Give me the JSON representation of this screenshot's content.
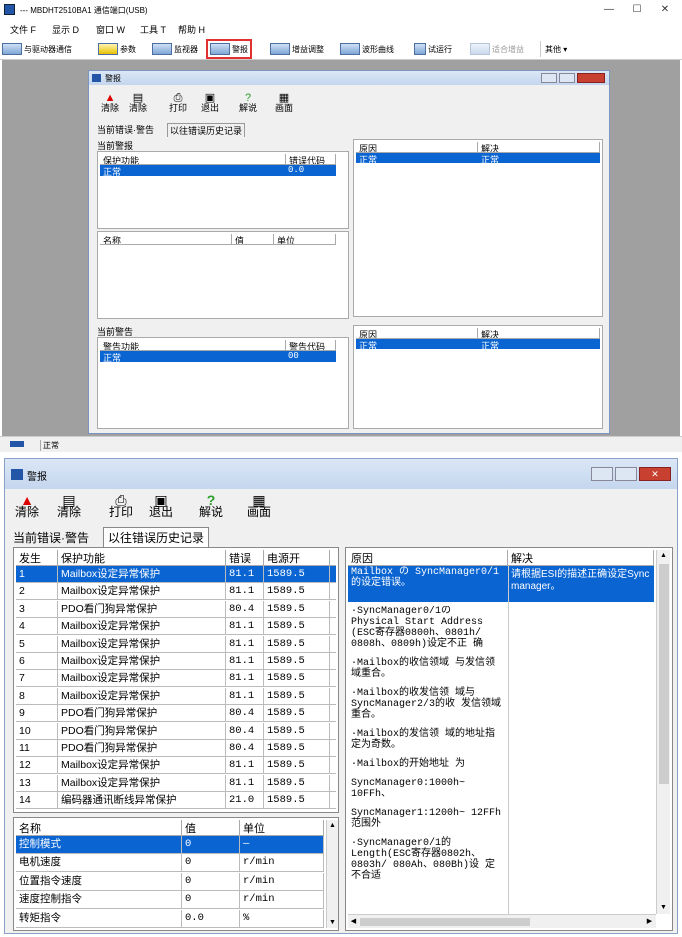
{
  "top": {
    "title": "--- MBDHT2510BA1  通信端口(USB)",
    "menu": [
      "文件 F",
      "显示 D",
      "窗口 W",
      "工具 T",
      "帮助 H"
    ],
    "toolbar": [
      "与驱动器通信",
      "参数",
      "监视器",
      "警报",
      "增益调整",
      "波形曲线",
      "试运行",
      "适合增益",
      "其他 ▾"
    ],
    "status": "正常",
    "alarm_window": {
      "title": "警报",
      "tools": [
        "清除",
        "清除",
        "打印",
        "退出",
        "解说",
        "画面"
      ],
      "tabs": [
        "当前错误·警告",
        "以往错误历史记录"
      ],
      "current_alarm_label": "当前警报",
      "alarm_headers": [
        "保护功能",
        "错误代码"
      ],
      "alarm_row": [
        "正常",
        "0.0"
      ],
      "name_headers": [
        "名称",
        "值",
        "单位"
      ],
      "cause_headers": [
        "原因",
        "解决"
      ],
      "cause_row": [
        "正常",
        "正常"
      ],
      "current_warning_label": "当前警告",
      "warning_headers": [
        "警告功能",
        "警告代码"
      ],
      "warning_row": [
        "正常",
        "00"
      ],
      "cause2_row": [
        "正常",
        "正常"
      ]
    }
  },
  "bottom": {
    "title": "警报",
    "tools": [
      "清除",
      "清除",
      "打印",
      "退出",
      "解说",
      "画面"
    ],
    "tabs": [
      "当前错误·警告",
      "以往错误历史记录"
    ],
    "history_headers": [
      "发生",
      "保护功能",
      "错误",
      "电源开"
    ],
    "history": [
      [
        "1",
        "Mailbox设定异常保护",
        "81.1",
        "1589.5"
      ],
      [
        "2",
        "Mailbox设定异常保护",
        "81.1",
        "1589.5"
      ],
      [
        "3",
        "PDO看门狗异常保护",
        "80.4",
        "1589.5"
      ],
      [
        "4",
        "Mailbox设定异常保护",
        "81.1",
        "1589.5"
      ],
      [
        "5",
        "Mailbox设定异常保护",
        "81.1",
        "1589.5"
      ],
      [
        "6",
        "Mailbox设定异常保护",
        "81.1",
        "1589.5"
      ],
      [
        "7",
        "Mailbox设定异常保护",
        "81.1",
        "1589.5"
      ],
      [
        "8",
        "Mailbox设定异常保护",
        "81.1",
        "1589.5"
      ],
      [
        "9",
        "PDO看门狗异常保护",
        "80.4",
        "1589.5"
      ],
      [
        "10",
        "PDO看门狗异常保护",
        "80.4",
        "1589.5"
      ],
      [
        "11",
        "PDO看门狗异常保护",
        "80.4",
        "1589.5"
      ],
      [
        "12",
        "Mailbox设定异常保护",
        "81.1",
        "1589.5"
      ],
      [
        "13",
        "Mailbox设定异常保护",
        "81.1",
        "1589.5"
      ],
      [
        "14",
        "编码器通讯断线异常保护",
        "21.0",
        "1589.5"
      ]
    ],
    "param_headers": [
      "名称",
      "值",
      "单位"
    ],
    "params": [
      [
        "控制模式",
        "0",
        "—"
      ],
      [
        "电机速度",
        "0",
        "r/min"
      ],
      [
        "位置指令速度",
        "0",
        "r/min"
      ],
      [
        "速度控制指令",
        "0",
        "r/min"
      ],
      [
        "转矩指令",
        "0.0",
        "%"
      ]
    ],
    "cause_headers": [
      "原因",
      "解决"
    ],
    "cause_selected": "Mailbox の SyncManager0/1的设定错误。",
    "solution_selected": "请根据ESI的描述正确设定Sync manager。",
    "cause_lines": [
      "·SyncManager0/1の Physical Start Address (ESC寄存器0800h、0801h/ 0808h、0809h)设定不正 确",
      "    ·Mailbox的收信领域 与发信领域重合。",
      "    ·Mailbox的收发信领 域与SyncManager2/3的收 发信领域重合。",
      "    ·Mailbox的发信领 域的地址指定为奇数。",
      "    ·Mailbox的开始地址 为",
      "SyncManager0:1000h~ 10FFh、",
      "SyncManager1:1200h~ 12FFh范围外",
      "·SyncManager0/1的 Length(ESC寄存器0802h、 0803h/ 080Ah、080Bh)设 定不合适"
    ]
  }
}
